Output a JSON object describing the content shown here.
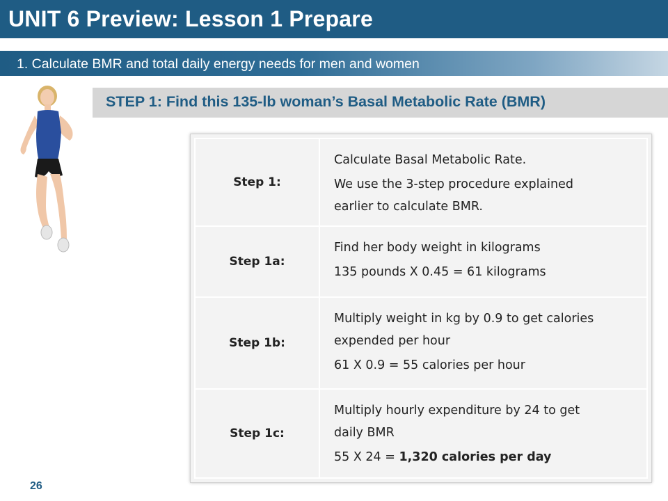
{
  "slide": {
    "title": "UNIT 6 Preview: Lesson 1 Prepare",
    "subtitle": "1. Calculate BMR and total daily energy needs for men and women",
    "step_heading": "STEP 1: Find this 135-lb woman’s Basal Metabolic Rate (BMR)",
    "page_number": "26",
    "image_icon": "woman-runner-image"
  },
  "table": {
    "rows": [
      {
        "label": "Step 1:",
        "lines": [
          "Calculate Basal Metabolic Rate.",
          "We use the 3-step procedure explained",
          "earlier to calculate BMR."
        ]
      },
      {
        "label": "Step 1a:",
        "lines": [
          "Find her body weight in kilograms",
          "135 pounds X 0.45 = 61 kilograms"
        ]
      },
      {
        "label": "Step 1b:",
        "lines": [
          "Multiply weight in kg by 0.9 to get calories",
          "expended per hour",
          "61 X 0.9 = 55 calories per hour"
        ]
      },
      {
        "label": "Step 1c:",
        "lines": [
          "Multiply hourly expenditure by 24 to get",
          "daily BMR"
        ],
        "result_prefix": "55 X 24 = ",
        "result_bold": "1,320 calories per day"
      }
    ]
  },
  "colors": {
    "primary": "#1f5c84",
    "step_bar": "#d6d6d6",
    "table_bg": "#f3f3f3"
  }
}
